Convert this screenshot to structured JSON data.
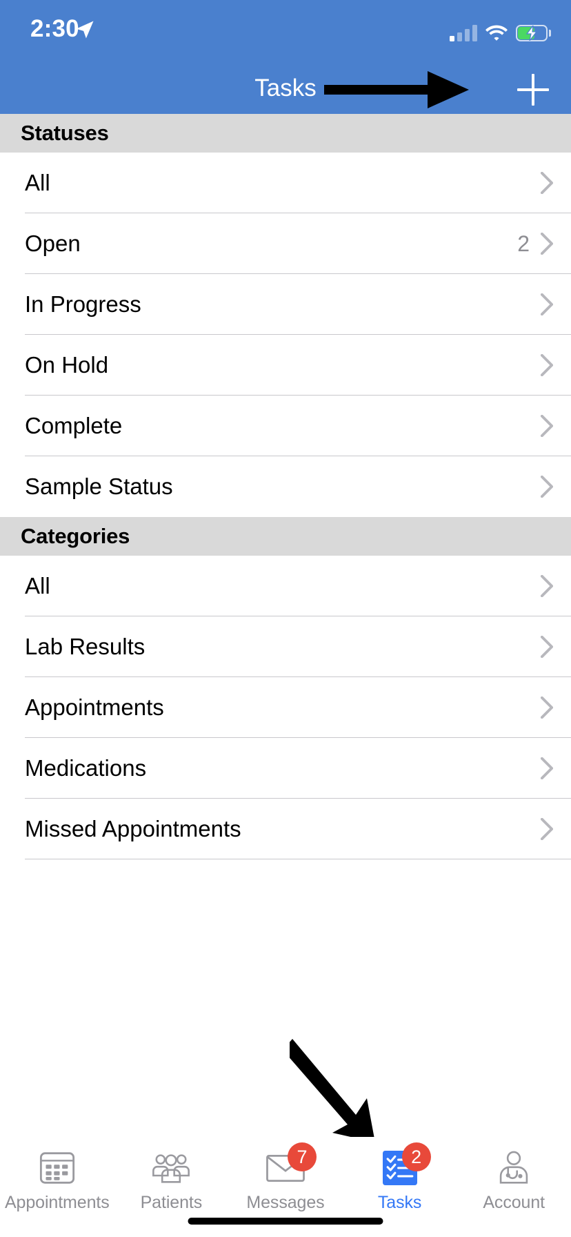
{
  "status_bar": {
    "time": "2:30",
    "location_icon": "location-arrow-icon",
    "signal_icon": "cellular-signal-icon",
    "signal_bars_filled": 1,
    "signal_bars_total": 4,
    "wifi_icon": "wifi-icon",
    "battery_icon": "battery-charging-icon",
    "battery_color": "#4ad863"
  },
  "nav_bar": {
    "title": "Tasks",
    "add_label": "+",
    "add_icon": "plus-icon",
    "background": "#4a80ce"
  },
  "sections": [
    {
      "header": "Statuses",
      "rows": [
        {
          "label": "All",
          "count": ""
        },
        {
          "label": "Open",
          "count": "2"
        },
        {
          "label": "In Progress",
          "count": ""
        },
        {
          "label": "On Hold",
          "count": ""
        },
        {
          "label": "Complete",
          "count": ""
        },
        {
          "label": "Sample Status",
          "count": ""
        }
      ]
    },
    {
      "header": "Categories",
      "rows": [
        {
          "label": "All",
          "count": ""
        },
        {
          "label": "Lab Results",
          "count": ""
        },
        {
          "label": "Appointments",
          "count": ""
        },
        {
          "label": "Medications",
          "count": ""
        },
        {
          "label": "Missed Appointments",
          "count": ""
        }
      ]
    }
  ],
  "annotations": [
    {
      "name": "arrow-to-add-button",
      "direction": "right",
      "color": "#000000"
    },
    {
      "name": "arrow-to-tasks-tab",
      "direction": "down-right",
      "color": "#000000"
    }
  ],
  "tab_bar": {
    "active": "Tasks",
    "accent": "#3478f6",
    "inactive_color": "#8e8e93",
    "badge_color": "#e8493a",
    "tabs": [
      {
        "label": "Appointments",
        "icon": "calendar-icon",
        "badge": ""
      },
      {
        "label": "Patients",
        "icon": "people-group-icon",
        "badge": ""
      },
      {
        "label": "Messages",
        "icon": "envelope-icon",
        "badge": "7"
      },
      {
        "label": "Tasks",
        "icon": "checklist-icon",
        "badge": "2"
      },
      {
        "label": "Account",
        "icon": "doctor-stethoscope-icon",
        "badge": ""
      }
    ]
  }
}
